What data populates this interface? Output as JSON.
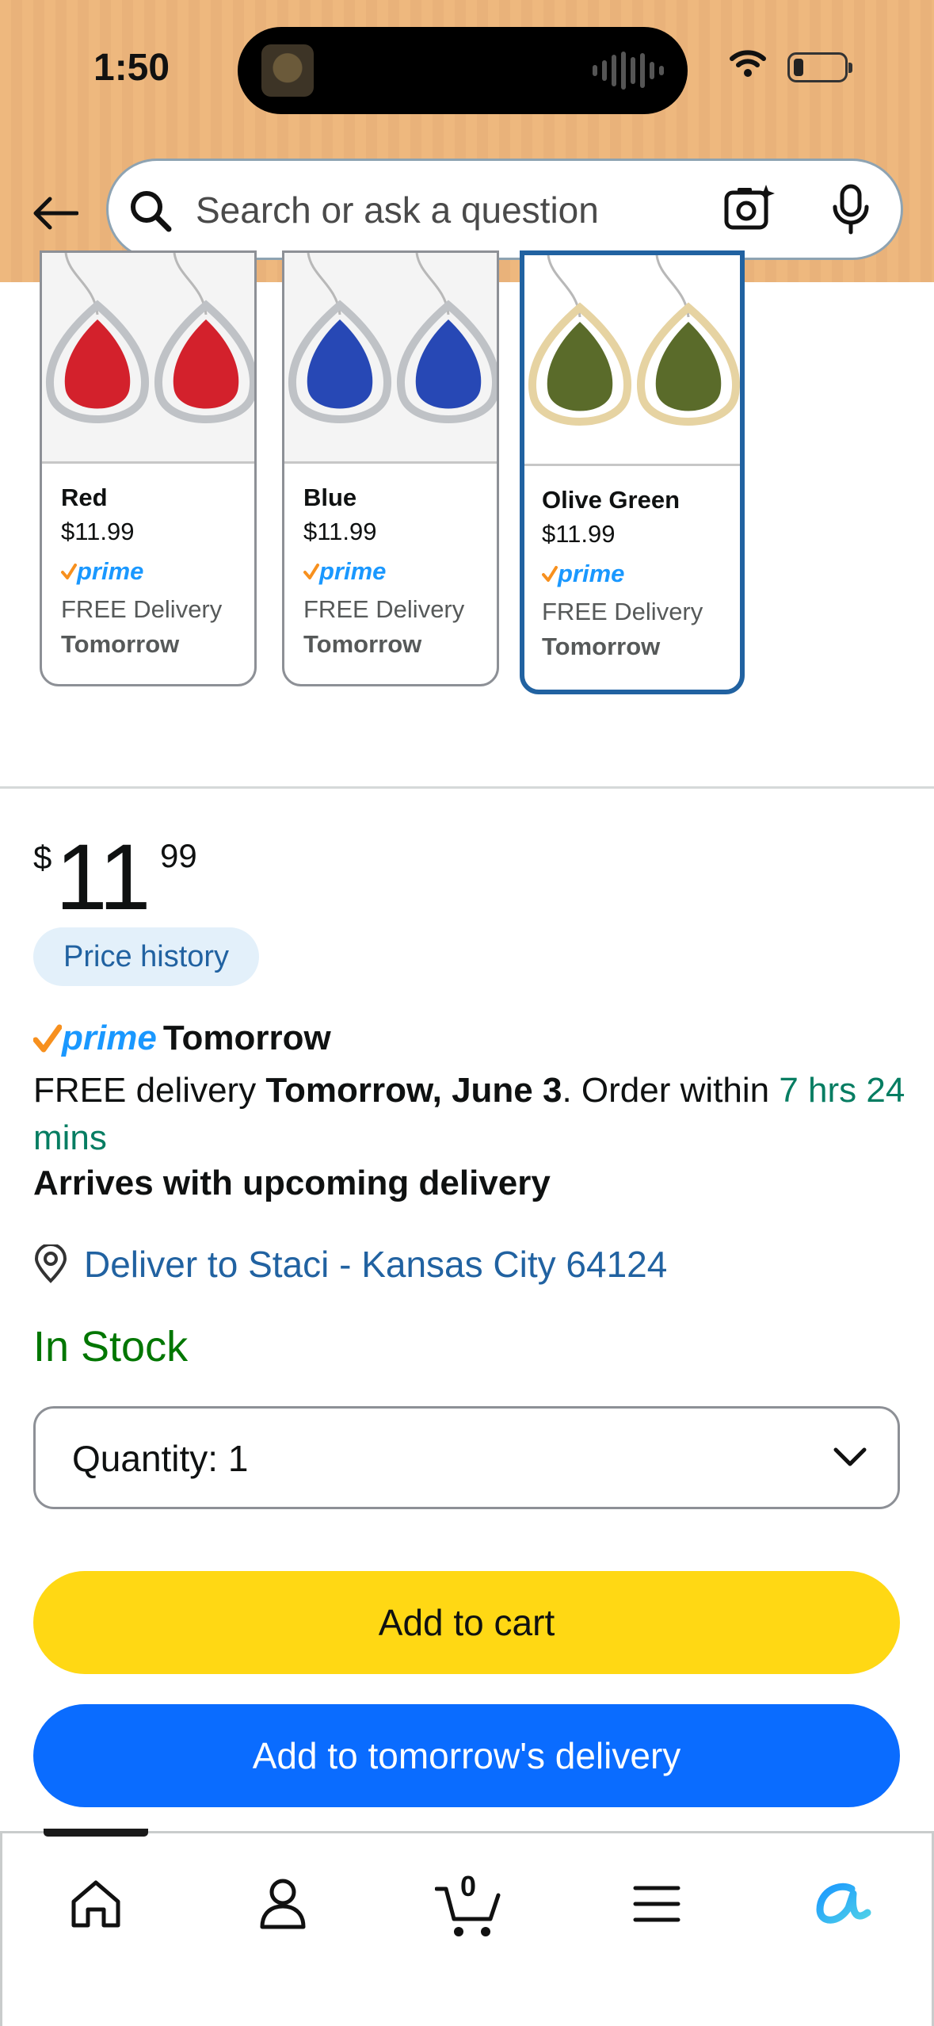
{
  "status_bar": {
    "time": "1:50"
  },
  "search": {
    "placeholder": "Search or ask a question"
  },
  "variations": [
    {
      "name": "Red",
      "price": "$11.99",
      "prime": "prime",
      "delivery": "FREE Delivery",
      "delivery_day": "Tomorrow",
      "color": "#D3212C",
      "frame": "#BFC2C6",
      "selected": false
    },
    {
      "name": "Blue",
      "price": "$11.99",
      "prime": "prime",
      "delivery": "FREE Delivery",
      "delivery_day": "Tomorrow",
      "color": "#2748B5",
      "frame": "#BFC2C6",
      "selected": false
    },
    {
      "name": "Olive Green",
      "price": "$11.99",
      "prime": "prime",
      "delivery": "FREE Delivery",
      "delivery_day": "Tomorrow",
      "color": "#5A6B2A",
      "frame": "#E6D3A2",
      "selected": true
    }
  ],
  "price": {
    "symbol": "$",
    "whole": "11",
    "fraction": "99"
  },
  "price_history_label": "Price history",
  "prime_badge": {
    "logo_text": "prime",
    "label": "Tomorrow"
  },
  "delivery": {
    "prefix": "FREE delivery ",
    "date": "Tomorrow, June 3",
    "middle": ". Order within ",
    "countdown": "7 hrs 24 mins",
    "arrives": "Arrives with upcoming delivery"
  },
  "deliver_to": {
    "label": "Deliver to Staci - Kansas City 64124"
  },
  "stock_status": "In Stock",
  "quantity": {
    "label": "Quantity:",
    "value": "1"
  },
  "buttons": {
    "add_to_cart": "Add to cart",
    "add_to_delivery": "Add to tomorrow's delivery"
  },
  "bottom_nav": {
    "cart_count": "0"
  },
  "colors": {
    "header_bg": "#EEB87E",
    "link_blue": "#2162A1",
    "prime_blue": "#1A98FF",
    "prime_check": "#F7901E",
    "in_stock_green": "#007600",
    "countdown_green": "#067D62",
    "cart_yellow": "#FFD814",
    "delivery_blue": "#0A6CFF"
  }
}
